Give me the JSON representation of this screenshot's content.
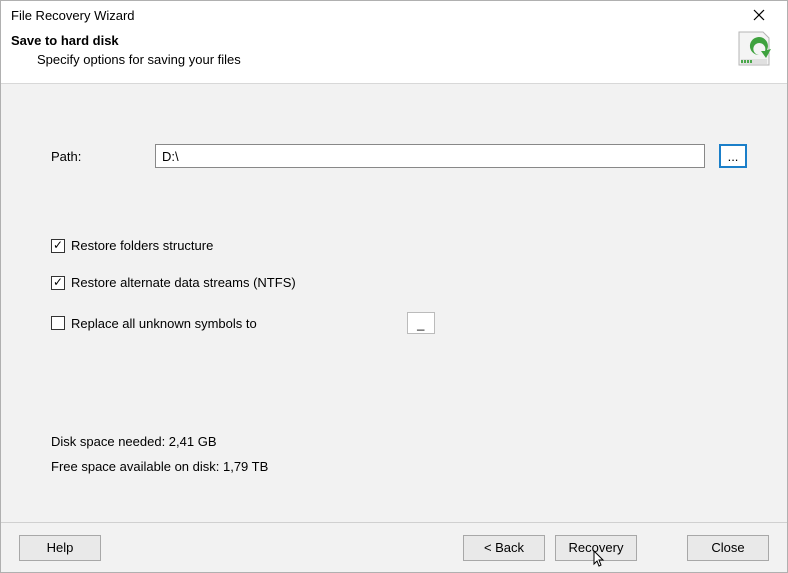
{
  "window": {
    "title": "File Recovery Wizard"
  },
  "header": {
    "title": "Save to hard disk",
    "subtitle": "Specify options for saving your files"
  },
  "path": {
    "label": "Path:",
    "value": "D:\\",
    "browse": "..."
  },
  "options": {
    "restore_folders": {
      "label": "Restore folders structure",
      "checked": true
    },
    "restore_ads": {
      "label": "Restore alternate data streams (NTFS)",
      "checked": true
    },
    "replace_symbols": {
      "label": "Replace all unknown symbols to",
      "checked": false,
      "value": "_"
    }
  },
  "disk": {
    "needed": "Disk space needed: 2,41 GB",
    "free": "Free space available on disk: 1,79 TB"
  },
  "footer": {
    "help": "Help",
    "back": "< Back",
    "recovery": "Recovery",
    "close": "Close"
  }
}
